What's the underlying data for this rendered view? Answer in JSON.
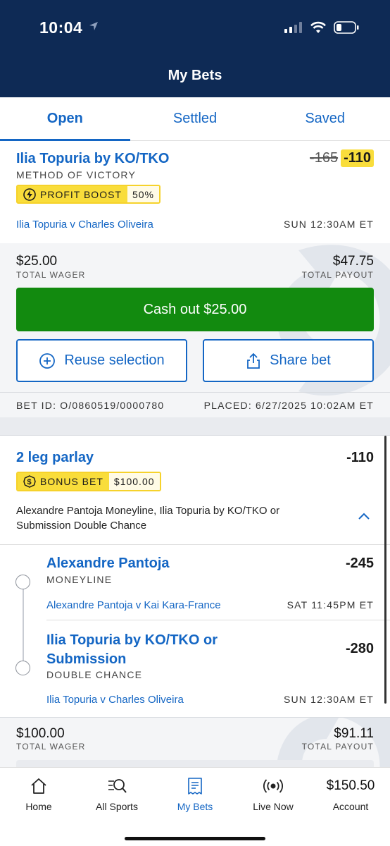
{
  "status_bar": {
    "time": "10:04"
  },
  "header": {
    "title": "My Bets"
  },
  "tabs": [
    {
      "label": "Open",
      "active": true
    },
    {
      "label": "Settled",
      "active": false
    },
    {
      "label": "Saved",
      "active": false
    }
  ],
  "bet1": {
    "selection": "Ilia Topuria by KO/TKO",
    "market": "METHOD OF VICTORY",
    "old_odds": "-165",
    "odds": "-110",
    "boost_label": "PROFIT BOOST",
    "boost_value": "50%",
    "event": "Ilia Topuria v Charles Oliveira",
    "event_time": "SUN 12:30AM ET",
    "wager": "$25.00",
    "wager_label": "TOTAL WAGER",
    "payout": "$47.75",
    "payout_label": "TOTAL PAYOUT",
    "cashout_label": "Cash out $25.00",
    "reuse_label": "Reuse selection",
    "share_label": "Share bet",
    "bet_id": "BET ID: O/0860519/0000780",
    "placed": "PLACED: 6/27/2025 10:02AM ET"
  },
  "bet2": {
    "title": "2 leg parlay",
    "odds": "-110",
    "bonus_label": "BONUS BET",
    "bonus_value": "$100.00",
    "description": "Alexandre Pantoja Moneyline, Ilia Topuria by KO/TKO or Submission Double Chance",
    "legs": [
      {
        "selection": "Alexandre Pantoja",
        "market": "MONEYLINE",
        "odds": "-245",
        "event": "Alexandre Pantoja v Kai Kara-France",
        "event_time": "SAT 11:45PM ET"
      },
      {
        "selection_line1": "Ilia Topuria by KO/TKO or",
        "selection_line2": "Submission",
        "market": "DOUBLE CHANCE",
        "odds": "-280",
        "event": "Ilia Topuria v Charles Oliveira",
        "event_time": "SUN 12:30AM ET"
      }
    ],
    "wager": "$100.00",
    "wager_label": "TOTAL WAGER",
    "payout": "$91.11",
    "payout_label": "TOTAL PAYOUT"
  },
  "bottom_nav": [
    {
      "label": "Home",
      "icon": "home-icon"
    },
    {
      "label": "All Sports",
      "icon": "search-sports-icon"
    },
    {
      "label": "My Bets",
      "icon": "bet-slip-icon",
      "active": true
    },
    {
      "label": "Live Now",
      "icon": "live-broadcast-icon"
    },
    {
      "label": "Account",
      "value": "$150.50"
    }
  ],
  "colors": {
    "brand_navy": "#0e2a55",
    "link_blue": "#1466c4",
    "cashout_green": "#128a0f",
    "boost_yellow": "#f9dd3b"
  }
}
